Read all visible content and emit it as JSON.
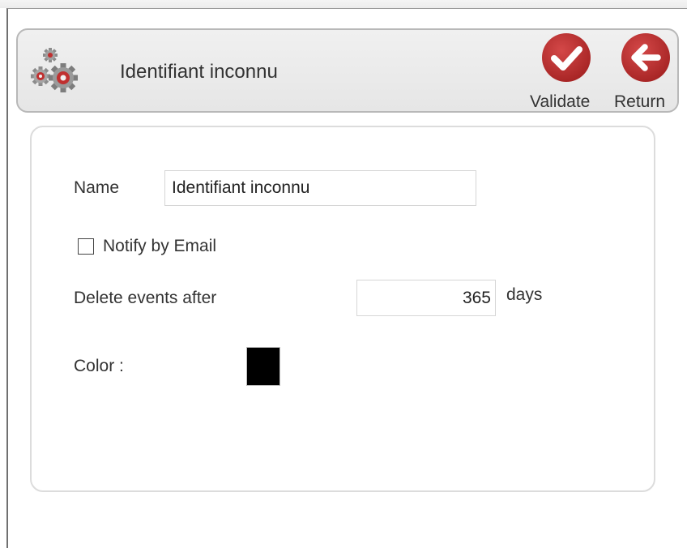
{
  "header": {
    "title": "Identifiant inconnu",
    "icon": "gears-icon",
    "validate_label": "Validate",
    "return_label": "Return"
  },
  "form": {
    "name_label": "Name",
    "name_value": "Identifiant inconnu",
    "notify_label": "Notify by Email",
    "notify_checked": false,
    "delete_label": "Delete events after",
    "delete_value": "365",
    "delete_unit": "days",
    "color_label": "Color :",
    "color_value": "#000000"
  },
  "colors": {
    "accent_red": "#b92d2d",
    "header_bg": "#e8e8e8"
  }
}
